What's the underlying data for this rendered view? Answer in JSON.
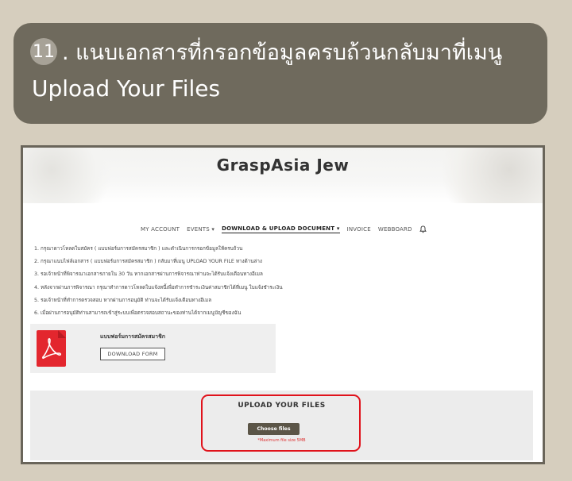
{
  "banner": {
    "step_number": "11",
    "line1": ". แนบเอกสารที่กรอกข้อมูลครบถ้วนกลับมาที่เมนู",
    "line2": "Upload Your Files"
  },
  "site": {
    "title": "GraspAsia Jew"
  },
  "nav": {
    "items": [
      "MY ACCOUNT",
      "EVENTS ▾",
      "DOWNLOAD & UPLOAD DOCUMENT ▾",
      "INVOICE",
      "WEBBOARD"
    ],
    "active_index": 2,
    "bell_icon": "bell-icon"
  },
  "steps": [
    "1. กรุณาดาวโหลดใบสมัคร ( แบบฟอร์มการสมัครสมาชิก ) และดำเนินการกรอกข้อมูลให้ครบถ้วน",
    "2. กรุณาแนบไฟล์เอกสาร ( แบบฟอร์มการสมัครสมาชิก ) กลับมาที่เมนู UPLOAD YOUR FILE ทางด้านล่าง",
    "3. รอเจ้าหน้าที่พิจารณาเอกสารภายใน 30 วัน หากเอกสารผ่านการพิจารณาท่านจะได้รับแจ้งเตือนทางอีเมล",
    "4. หลังจากผ่านการพิจารณา กรุณาทำการดาวโหลดใบแจ้งหนี้เพื่อทำการชำระเงินค่าสมาชิกได้ที่เมนู ใบแจ้งชำระเงิน",
    "5. รอเจ้าหน้าที่ทำการตรวจสอบ หากผ่านการอนุมัติ ท่านจะได้รับแจ้งเตือนทางอีเมล",
    "6. เมื่อผ่านการอนุมัติท่านสามารถเข้าสู่ระบบเพื่อตรวจสอบสถานะของท่านได้จากเมนูบัญชีของฉัน"
  ],
  "form_card": {
    "title": "แบบฟอร์มการสมัครสมาชิก",
    "download_label": "DOWNLOAD FORM",
    "icon": "pdf-icon",
    "icon_color": "#e3262e"
  },
  "upload": {
    "title": "UPLOAD YOUR FILES",
    "choose_label": "Choose files",
    "max_note": "*Maximum file size 5MB",
    "highlight_color": "#e0121b"
  }
}
